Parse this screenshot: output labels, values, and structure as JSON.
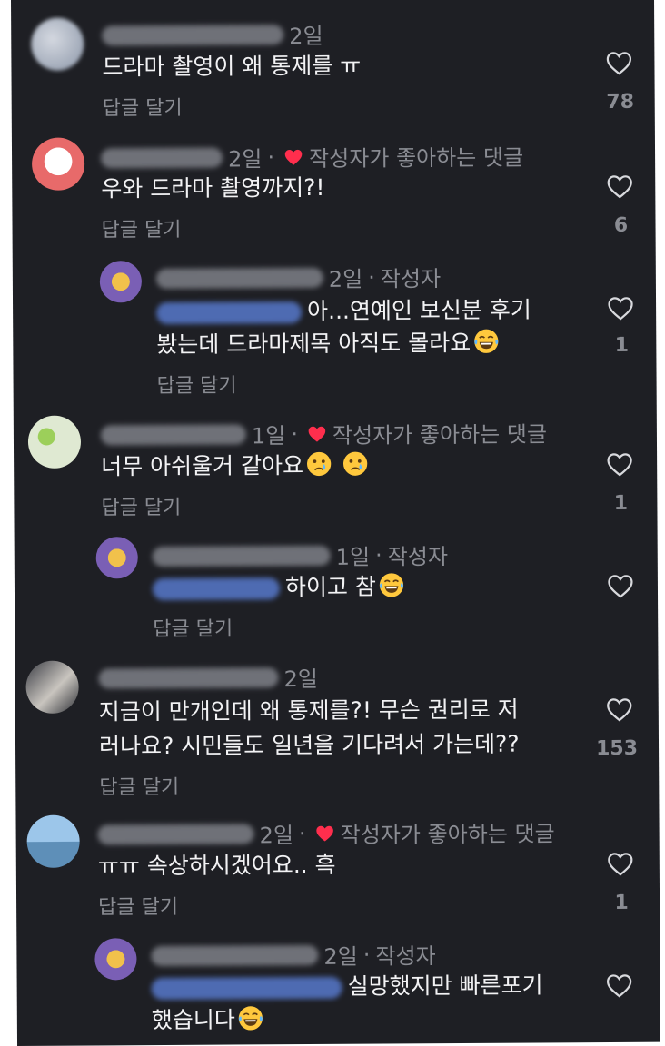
{
  "ui": {
    "reply_label": "답글 달기",
    "liked_by_author": "작성자가 좋아하는 댓글",
    "author_tag": "작성자",
    "dot": "·",
    "accent_red": "#ff2e4d",
    "mention_color": "#5a7ed6"
  },
  "comments": [
    {
      "time": "2일",
      "text": "드라마 촬영이 왜 통제를 ㅠ",
      "likes": "78"
    },
    {
      "time": "2일",
      "text": "우와 드라마 촬영까지?!",
      "likes": "6"
    },
    {
      "time": "2일",
      "text_line1": "아...연예인 보신분 후기",
      "text_line2": "봤는데 드라마제목 아직도 몰라요",
      "likes": "1"
    },
    {
      "time": "1일",
      "text": "너무 아쉬울거 같아요",
      "likes": "1"
    },
    {
      "time": "1일",
      "text": "하이고 참",
      "likes": ""
    },
    {
      "time": "2일",
      "text_line1": "지금이 만개인데 왜 통제를?! 무슨 권리로 저",
      "text_line2": "러나요? 시민들도 일년을 기다려서 가는데??",
      "likes": "153"
    },
    {
      "time": "2일",
      "text": "ㅠㅠ 속상하시겠어요.. 흑",
      "likes": "1"
    },
    {
      "time": "2일",
      "text_line1": "실망했지만 빠른포기",
      "text_line2": "했습니다",
      "likes": ""
    }
  ]
}
